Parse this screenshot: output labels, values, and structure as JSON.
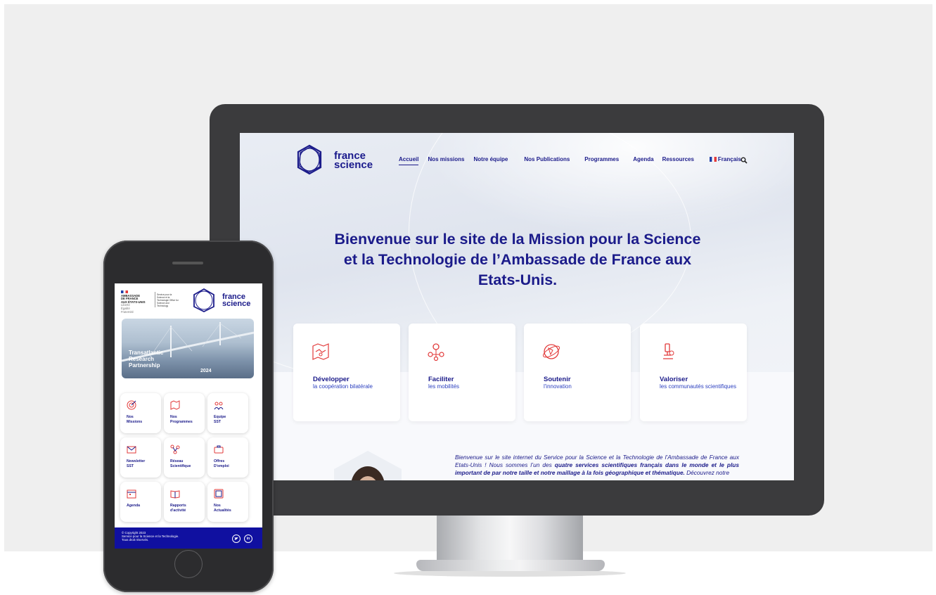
{
  "desktop": {
    "logo": {
      "line1": "france",
      "line2": "science"
    },
    "nav": [
      "Accueil",
      "Nos missions",
      "Notre équipe",
      "Nos Publications",
      "Programmes",
      "Agenda",
      "Ressources",
      "Français"
    ],
    "active_nav": "Accueil",
    "hero_title": "Bienvenue sur le site de la Mission pour la Science et la Technologie de l’Ambassade de France aux Etats-Unis.",
    "cards": [
      {
        "title": "Développer",
        "subtitle": "la coopération bilatérale",
        "icon": "handshake-map-icon"
      },
      {
        "title": "Faciliter",
        "subtitle": "les mobilités",
        "icon": "location-network-icon"
      },
      {
        "title": "Soutenir",
        "subtitle": "l'innovation",
        "icon": "globe-rocket-icon"
      },
      {
        "title": "Valoriser",
        "subtitle": "les communautés scientifiques",
        "icon": "microscope-icon"
      }
    ],
    "intro_part1": "Bienvenue sur le site internet du Service pour la Science et la Technologie de l’Ambassade de France aux Etats-Unis ! Nous sommes l’un des ",
    "intro_bold": "quatre services scientifiques français dans le monde et le plus important de par notre taille et notre maillage à la fois géographique et thématique.",
    "intro_part2": " Découvrez notre"
  },
  "mobile": {
    "ambassade": [
      "AMBASSADE",
      "DE FRANCE",
      "AUX ÉTATS-UNIS"
    ],
    "ambassade_motto": [
      "Liberté",
      "Égalité",
      "Fraternité"
    ],
    "service": "Service pour la Science et la Technologie Office for Science and Technology",
    "logo": {
      "line1": "france",
      "line2": "science"
    },
    "banner_lines": [
      "Transatlantic",
      "Research",
      "Partnership"
    ],
    "banner_year": "2024",
    "tiles": [
      {
        "l1": "Nos",
        "l2": "Missions",
        "icon": "target-icon"
      },
      {
        "l1": "Nos",
        "l2": "Programmes",
        "icon": "map-icon"
      },
      {
        "l1": "Equipe",
        "l2": "SST",
        "icon": "team-icon"
      },
      {
        "l1": "Newsletter",
        "l2": "SST",
        "icon": "envelope-icon"
      },
      {
        "l1": "Réseau",
        "l2": "Scientifique",
        "icon": "network-icon"
      },
      {
        "l1": "Offres",
        "l2": "D'emploi",
        "icon": "briefcase-icon"
      },
      {
        "l1": "Agenda",
        "l2": "",
        "icon": "calendar-icon"
      },
      {
        "l1": "Rapports",
        "l2": "d'activité",
        "icon": "book-icon"
      },
      {
        "l1": "Nos",
        "l2": "Actualités",
        "icon": "news-icon"
      }
    ],
    "footer": [
      "© Copyright 2023",
      "Service pour la Science et la Technologie.",
      "Tous droit réservés."
    ],
    "social": [
      "twitter",
      "in"
    ]
  },
  "colors": {
    "brand_blue": "#1b1b8a",
    "accent_red": "#e23a3a",
    "footer_blue": "#1010a0"
  }
}
